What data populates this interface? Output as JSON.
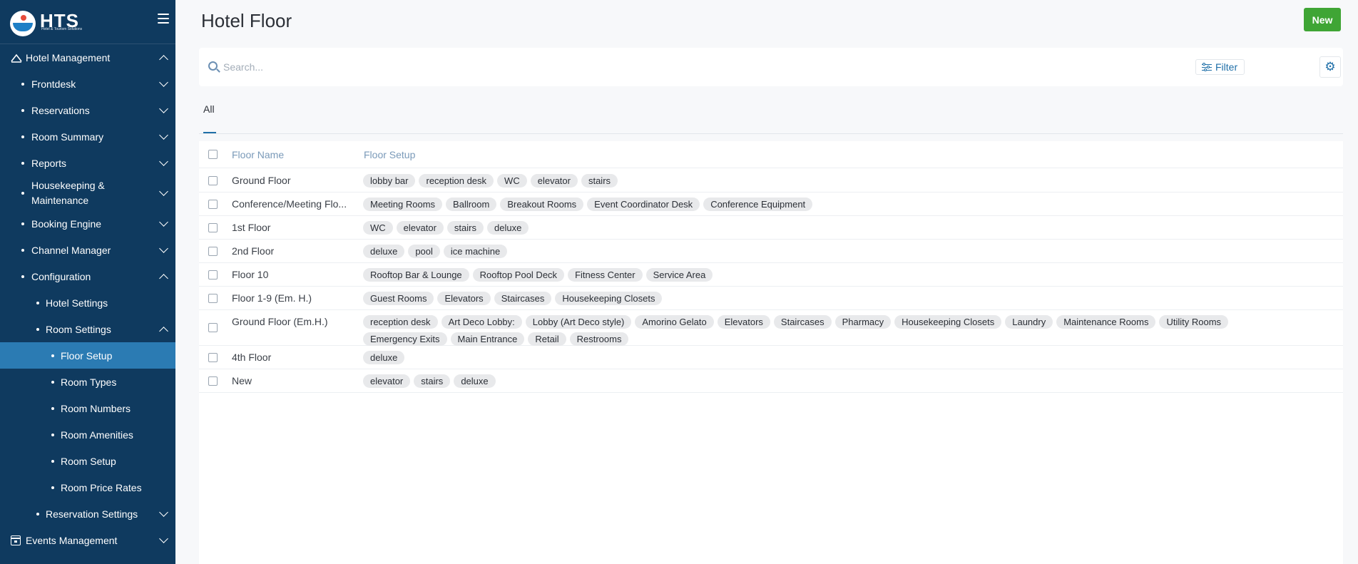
{
  "brand": {
    "name": "HTS",
    "tagline": "Hotel & Tourism Solutions"
  },
  "sidebar": {
    "items": [
      {
        "label": "Hotel Management",
        "level": 0,
        "icon": "house-icon",
        "expanded": true
      },
      {
        "label": "Frontdesk",
        "level": 1,
        "expanded": false
      },
      {
        "label": "Reservations",
        "level": 1,
        "expanded": false
      },
      {
        "label": "Room Summary",
        "level": 1,
        "expanded": false
      },
      {
        "label": "Reports",
        "level": 1,
        "expanded": false
      },
      {
        "label": "Housekeeping & Maintenance",
        "level": 1,
        "expanded": false
      },
      {
        "label": "Booking Engine",
        "level": 1,
        "expanded": false
      },
      {
        "label": "Channel Manager",
        "level": 1,
        "expanded": false
      },
      {
        "label": "Configuration",
        "level": 1,
        "expanded": true
      },
      {
        "label": "Hotel Settings",
        "level": 2
      },
      {
        "label": "Room Settings",
        "level": 2,
        "expanded": true
      },
      {
        "label": "Floor Setup",
        "level": 3,
        "active": true
      },
      {
        "label": "Room Types",
        "level": 3
      },
      {
        "label": "Room Numbers",
        "level": 3
      },
      {
        "label": "Room Amenities",
        "level": 3
      },
      {
        "label": "Room Setup",
        "level": 3
      },
      {
        "label": "Room Price Rates",
        "level": 3
      },
      {
        "label": "Reservation Settings",
        "level": 2,
        "expanded": false
      },
      {
        "label": "Events Management",
        "level": 0,
        "icon": "calendar-icon",
        "expanded": false
      }
    ]
  },
  "header": {
    "title": "Hotel Floor",
    "new_label": "New"
  },
  "search": {
    "placeholder": "Search...",
    "filter_label": "Filter"
  },
  "tabs": [
    {
      "label": "All",
      "active": true
    }
  ],
  "table": {
    "columns": [
      "Floor Name",
      "Floor Setup"
    ],
    "rows": [
      {
        "name": "Ground Floor",
        "tags": [
          "lobby bar",
          "reception desk",
          "WC",
          "elevator",
          "stairs"
        ]
      },
      {
        "name": "Conference/Meeting Flo...",
        "tags": [
          "Meeting Rooms",
          "Ballroom",
          "Breakout Rooms",
          "Event Coordinator Desk",
          "Conference Equipment"
        ]
      },
      {
        "name": "1st Floor",
        "tags": [
          "WC",
          "elevator",
          "stairs",
          "deluxe"
        ]
      },
      {
        "name": "2nd Floor",
        "tags": [
          "deluxe",
          "pool",
          "ice machine"
        ]
      },
      {
        "name": "Floor 10",
        "tags": [
          "Rooftop Bar & Lounge",
          "Rooftop Pool Deck",
          "Fitness Center",
          "Service Area"
        ]
      },
      {
        "name": "Floor 1-9 (Em. H.)",
        "tags": [
          "Guest Rooms",
          "Elevators",
          "Staircases",
          "Housekeeping Closets"
        ]
      },
      {
        "name": "Ground Floor (Em.H.)",
        "tags": [
          "reception desk",
          "Art Deco Lobby:",
          "Lobby (Art Deco style)",
          "Amorino Gelato",
          "Elevators",
          "Staircases",
          "Pharmacy",
          "Housekeeping Closets",
          "Laundry",
          "Maintenance Rooms",
          "Utility Rooms",
          "Emergency Exits",
          "Main Entrance",
          "Retail",
          "Restrooms"
        ]
      },
      {
        "name": "4th Floor",
        "tags": [
          "deluxe"
        ]
      },
      {
        "name": "New",
        "tags": [
          "elevator",
          "stairs",
          "deluxe"
        ]
      }
    ]
  },
  "colors": {
    "sidebar": "#0f3a5f",
    "active": "#2b7bb3",
    "primary_button": "#3fa535",
    "accent": "#1f6fa8"
  }
}
